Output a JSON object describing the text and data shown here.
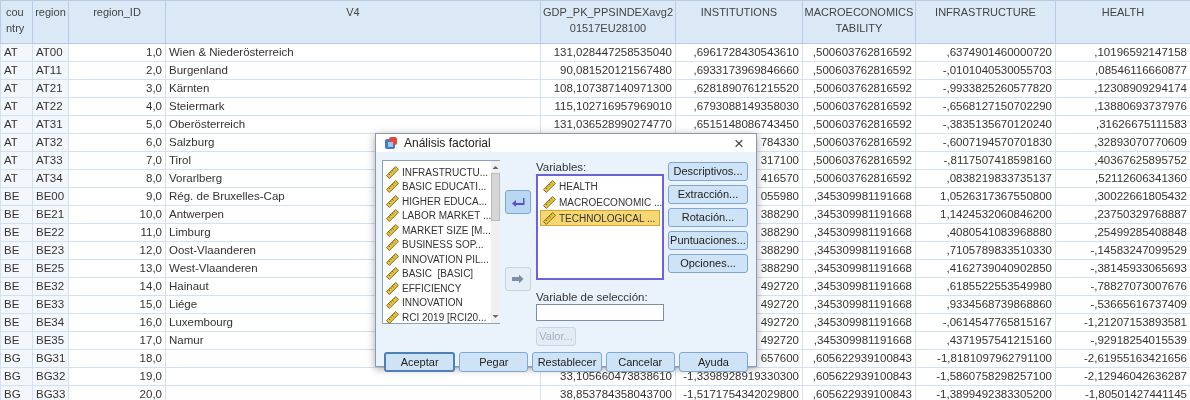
{
  "table": {
    "columns": [
      "country",
      "region",
      "region_ID",
      "V4",
      "GDP_PK_PPSINDEXavg201517EU28100",
      "INSTITUTIONS",
      "MACROECONOMICSTABILITY",
      "INFRASTRUCTURE",
      "HEALTH"
    ],
    "rows": [
      {
        "cells": [
          "AT",
          "AT00",
          "1,0",
          "Wien & Niederösterreich",
          "131,028447258535040",
          ",6961728430543610",
          ",500603762816592",
          ",6374901460000720",
          ",10196592147158"
        ]
      },
      {
        "cells": [
          "AT",
          "AT11",
          "2,0",
          "Burgenland",
          "90,081520121567480",
          ",6933173969846660",
          ",500603762816592",
          "-,0101040530055703",
          ",08546116660877"
        ]
      },
      {
        "cells": [
          "AT",
          "AT21",
          "3,0",
          "Kärnten",
          "108,107387140971300",
          ",6281890761215520",
          ",500603762816592",
          "-,9933825260577820",
          ",12308909294174"
        ]
      },
      {
        "cells": [
          "AT",
          "AT22",
          "4,0",
          "Steiermark",
          "115,102716957969010",
          ",6793088149358030",
          ",500603762816592",
          "-,6568127150702290",
          ",13880693737976"
        ]
      },
      {
        "cells": [
          "AT",
          "AT31",
          "5,0",
          "Oberösterreich",
          "131,036528990274770",
          ",6515148086743450",
          ",500603762816592",
          "-,3835135670120240",
          ",31626675111583"
        ]
      },
      {
        "cells": [
          "AT",
          "AT32",
          "6,0",
          "Salzburg",
          null,
          "784330",
          ",500603762816592",
          "-,6007194570701830",
          ",32893070770609"
        ]
      },
      {
        "cells": [
          "AT",
          "AT33",
          "7,0",
          "Tirol",
          null,
          "317100",
          ",500603762816592",
          "-,8117507418598160",
          ",40367625895752"
        ]
      },
      {
        "cells": [
          "AT",
          "AT34",
          "8,0",
          "Vorarlberg",
          null,
          "416570",
          ",500603762816592",
          ",0838219833735137",
          ",52112606341360"
        ]
      },
      {
        "cells": [
          "BE",
          "BE00",
          "9,0",
          "Rég. de Bruxelles-Cap",
          null,
          "055980",
          ",345309981191668",
          "1,0526317367550800",
          ",30022661805432"
        ]
      },
      {
        "cells": [
          "BE",
          "BE21",
          "10,0",
          "Antwerpen",
          null,
          "388290",
          ",345309981191668",
          "1,1424532060846200",
          ",23750329768887"
        ]
      },
      {
        "cells": [
          "BE",
          "BE22",
          "11,0",
          "Limburg",
          null,
          "388290",
          ",345309981191668",
          ",4080541083968880",
          ",25499285408848"
        ]
      },
      {
        "cells": [
          "BE",
          "BE23",
          "12,0",
          "Oost-Vlaanderen",
          null,
          "388290",
          ",345309981191668",
          ",7105789833510330",
          "-,14583247099529"
        ]
      },
      {
        "cells": [
          "BE",
          "BE25",
          "13,0",
          "West-Vlaanderen",
          null,
          "388290",
          ",345309981191668",
          ",4162739040902850",
          "-,38145933065693"
        ]
      },
      {
        "cells": [
          "BE",
          "BE32",
          "14,0",
          "Hainaut",
          null,
          "492720",
          ",345309981191668",
          ",6185522553549980",
          "-,78827073007676"
        ]
      },
      {
        "cells": [
          "BE",
          "BE33",
          "15,0",
          "Liége",
          null,
          "492720",
          ",345309981191668",
          ",9334568739868860",
          "-,53665616737409"
        ]
      },
      {
        "cells": [
          "BE",
          "BE34",
          "16,0",
          "Luxembourg",
          null,
          "492720",
          ",345309981191668",
          "-,0614547765815167",
          "-1,21207153893581"
        ]
      },
      {
        "cells": [
          "BE",
          "BE35",
          "17,0",
          "Namur",
          null,
          "492720",
          ",345309981191668",
          ",4371957541215160",
          "-,92918254015539"
        ]
      },
      {
        "cells": [
          "BG",
          "BG31",
          "18,0",
          null,
          null,
          "657600",
          ",605622939100843",
          "-1,8181097962791100",
          "-2,61955163421656"
        ]
      },
      {
        "cells": [
          "BG",
          "BG32",
          "19,0",
          null,
          "33,105660473838610",
          "-1,3398928919330300",
          ",605622939100843",
          "-1,5860758298257100",
          "-2,12946042636287"
        ]
      },
      {
        "cells": [
          "BG",
          "BG33",
          "20,0",
          null,
          "38,853784358043700",
          "-1,5171754342029800",
          ",605622939100843",
          "-1,3899492383305200",
          "-1,80501427441145"
        ]
      }
    ]
  },
  "dialog": {
    "title": "Análisis factorial",
    "close": "×",
    "source_variables": [
      "INFRASTRUCTU...",
      "BASIC EDUCATI...",
      "HIGHER EDUCA...",
      "LABOR MARKET ...",
      "MARKET SIZE [M...",
      "BUSINESS SOP...",
      "INNOVATION PIL...",
      "BASIC  [BASIC]",
      "EFFICIENCY",
      "INNOVATION",
      "RCI 2019 [RCI20..."
    ],
    "move_buttons": [
      {
        "disabled": false
      },
      {
        "disabled": true
      }
    ],
    "variables_label": "Variables:",
    "variables": [
      {
        "label": "HEALTH",
        "selected": false
      },
      {
        "label": "MACROECONOMIC ...",
        "selected": false
      },
      {
        "label": "TECHNOLOGICAL ...",
        "selected": true
      }
    ],
    "selection_label": "Variable de selección:",
    "value_button": {
      "label": "Valor...",
      "disabled": true
    },
    "side_buttons": [
      "Descriptivos...",
      "Extracción...",
      "Rotación...",
      "Puntuaciones...",
      "Opciones..."
    ],
    "bottom_buttons": [
      {
        "label": "Aceptar",
        "default": true
      },
      {
        "label": "Pegar",
        "default": false
      },
      {
        "label": "Restablecer",
        "default": false
      },
      {
        "label": "Cancelar",
        "default": false
      },
      {
        "label": "Ayuda",
        "default": false
      }
    ]
  }
}
